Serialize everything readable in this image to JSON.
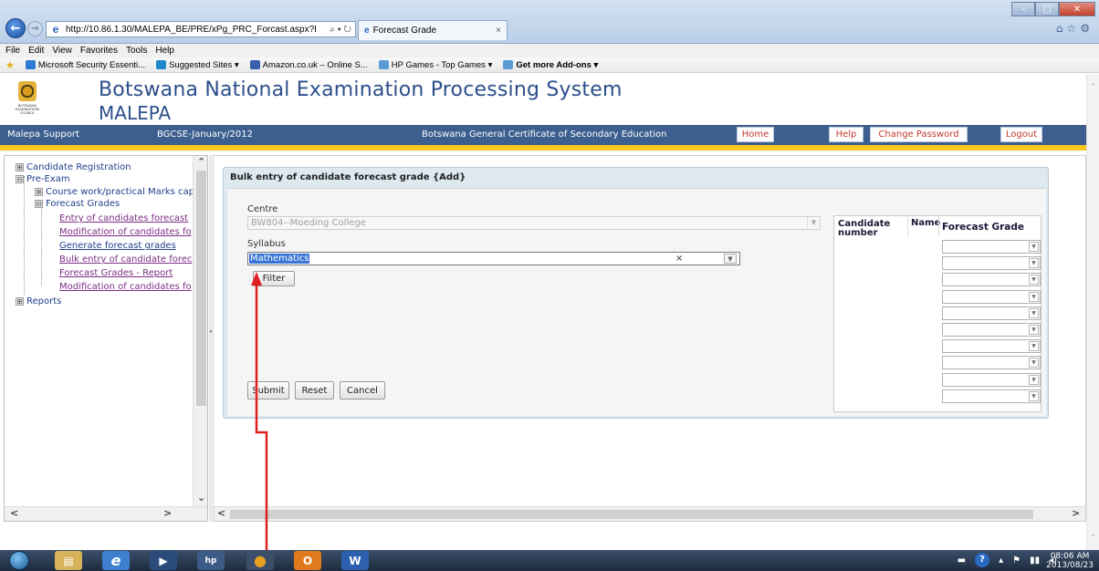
{
  "browser": {
    "address": "http://10.86.1.30/MALEPA_BE/PRE/xPg_PRC_Forcast.aspx?I",
    "address_tools": "⌕ ▾ ↻",
    "tab_title": "Forecast Grade",
    "tab_close": "×",
    "back": "←",
    "forward": "→",
    "window_controls": {
      "minimize": "–",
      "maximize": "□",
      "close": "✕"
    },
    "menu": [
      "File",
      "Edit",
      "View",
      "Favorites",
      "Tools",
      "Help"
    ],
    "favorites": [
      {
        "label": "Microsoft Security Essenti...",
        "color": "#2e7bd6"
      },
      {
        "label": "Suggested Sites ▾",
        "color": "#1e88c8"
      },
      {
        "label": "Amazon.co.uk – Online S...",
        "color": "#3a5faa"
      },
      {
        "label": "HP Games - Top Games ▾",
        "color": "#5b9bd5"
      },
      {
        "label": "Get more Add-ons ▾",
        "color": "#5b9bd5"
      }
    ]
  },
  "header": {
    "title": "Botswana National Examination Processing System",
    "subtitle": "MALEPA",
    "logo_text": "BOTSWANA EXAMINATIONS COUNCIL"
  },
  "navbar": {
    "left": "Malepa Support",
    "exam": "BGCSE-January/2012",
    "center": "Botswana General Certificate of Secondary Education",
    "links": [
      "Home",
      "Help",
      "Change Password",
      "Logout"
    ]
  },
  "tree": {
    "nodes": [
      {
        "label": "Candidate Registration",
        "symbol": "⊞"
      },
      {
        "label": "Pre-Exam",
        "symbol": "⊟"
      },
      {
        "label": "Course work/practical Marks capt",
        "symbol": "⊞"
      },
      {
        "label": "Forecast Grades",
        "symbol": "⊟"
      },
      {
        "label": "Reports",
        "symbol": "⊞"
      }
    ],
    "leaves": [
      "Entry of candidates forecast",
      "Modification of candidates fo",
      "Generate forecast grades",
      "Bulk entry of candidate forec",
      "Forecast Grades - Report",
      "Modification of candidates fo"
    ]
  },
  "form": {
    "title": "Bulk entry of candidate forecast grade {Add}",
    "centre_label": "Centre",
    "centre_value": "BW804--Moeding College",
    "syllabus_label": "Syllabus",
    "syllabus_value": "Mathematics",
    "syllabus_clear": "×",
    "filter_label": "Filter",
    "submit_label": "Submit",
    "reset_label": "Reset",
    "cancel_label": "Cancel"
  },
  "grid": {
    "headers": {
      "candidate_number": "Candidate number",
      "name": "Name",
      "forecast_grade": "Forecast Grade"
    },
    "row_count": 10
  },
  "taskbar": {
    "time": "08:06 AM",
    "date": "2013/08/23"
  },
  "colors": {
    "header_text": "#2c4f8c",
    "navbar_bg": "#3d5f8f",
    "accent_yellow": "#f7c91e",
    "annotation_red": "#e02020"
  }
}
